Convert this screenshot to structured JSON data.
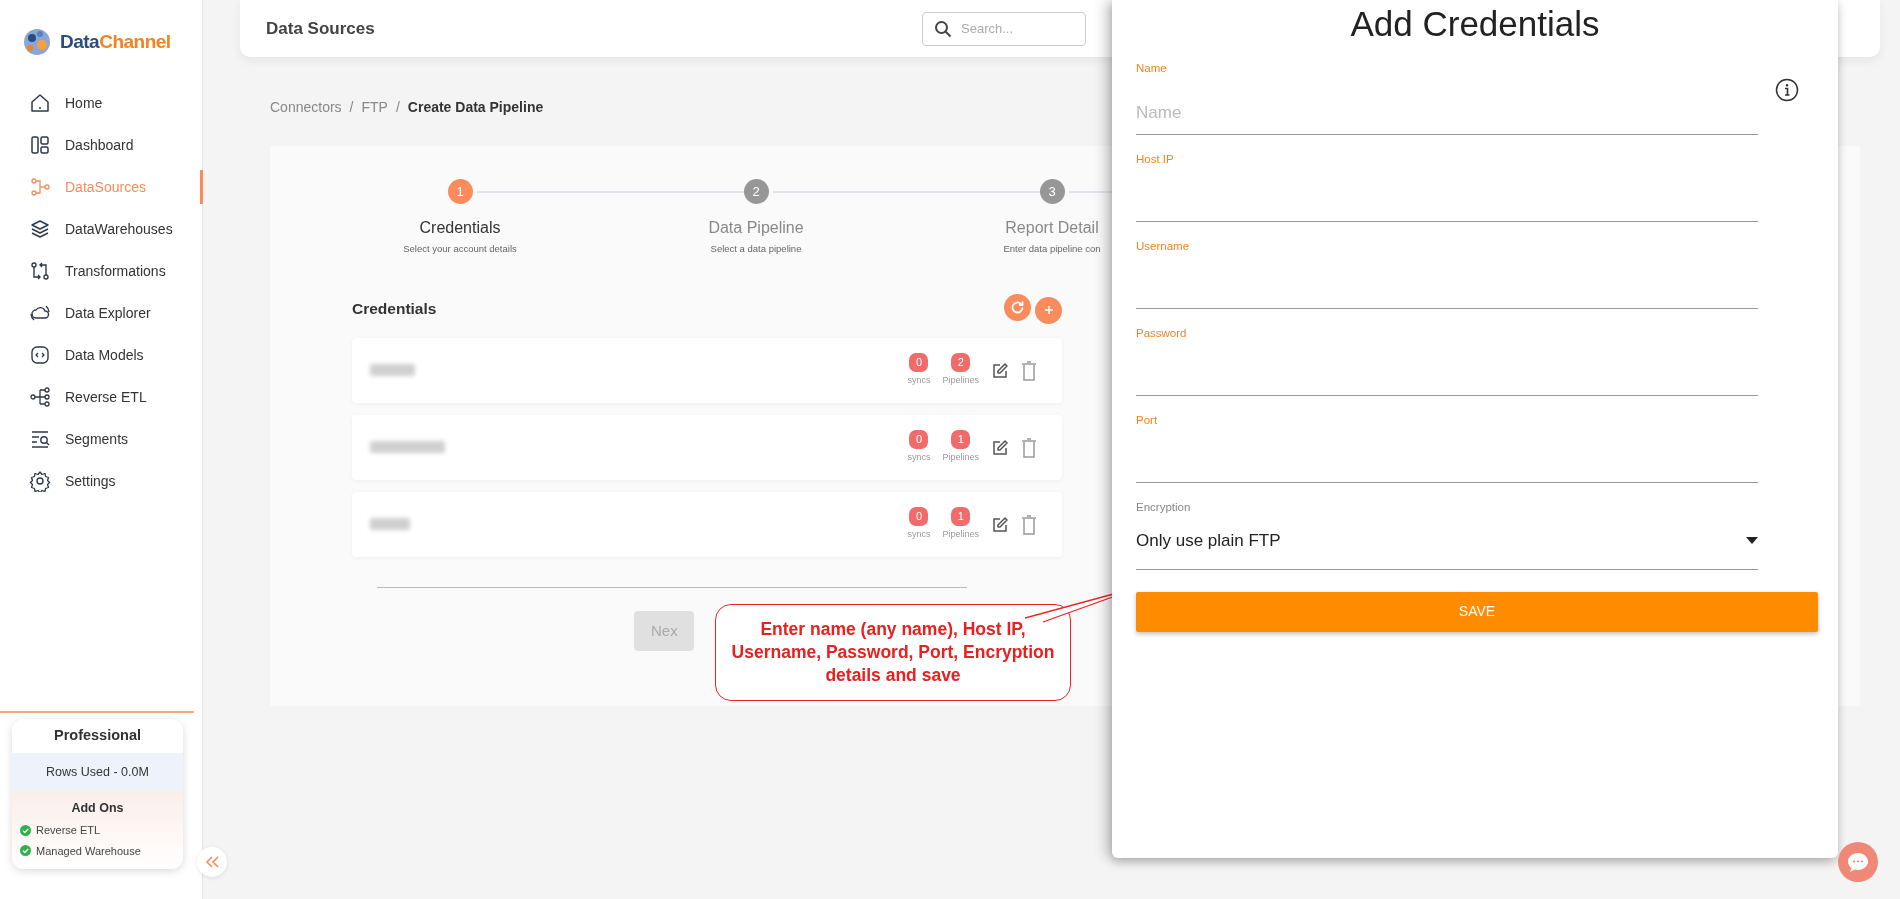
{
  "logo": {
    "first": "Data",
    "second": "Channel"
  },
  "sidebar": {
    "items": [
      {
        "label": "Home",
        "selected": false
      },
      {
        "label": "Dashboard",
        "selected": false
      },
      {
        "label": "DataSources",
        "selected": true
      },
      {
        "label": "DataWarehouses",
        "selected": false
      },
      {
        "label": "Transformations",
        "selected": false
      },
      {
        "label": "Data Explorer",
        "selected": false
      },
      {
        "label": "Data Models",
        "selected": false
      },
      {
        "label": "Reverse ETL",
        "selected": false
      },
      {
        "label": "Segments",
        "selected": false
      },
      {
        "label": "Settings",
        "selected": false
      }
    ]
  },
  "plan": {
    "name": "Professional",
    "usage": "Rows Used - 0.0M",
    "addons_title": "Add Ons",
    "addons": [
      {
        "label": "Reverse ETL",
        "enabled": true
      },
      {
        "label": "Managed Warehouse",
        "enabled": true
      }
    ]
  },
  "header": {
    "title": "Data Sources",
    "search": {
      "placeholder": "Search..."
    }
  },
  "breadcrumbs": [
    {
      "label": "Connectors",
      "current": false
    },
    {
      "label": "FTP",
      "current": false,
      "separator": "/"
    },
    {
      "label": "Create Data Pipeline",
      "current": true,
      "separator": "/"
    }
  ],
  "steps": [
    {
      "number": "1",
      "title": "Credentials",
      "subtitle": "Select your account details",
      "selected": true
    },
    {
      "number": "2",
      "title": "Data Pipeline",
      "subtitle": "Select a data pipeline",
      "selected": false
    },
    {
      "number": "3",
      "title": "Report Detail",
      "subtitle": "Enter data pipeline con",
      "selected": false
    }
  ],
  "credentials": {
    "title": "Credentials",
    "rows": [
      {
        "syncs": "0",
        "syncs_label": "syncs",
        "pipelines": "2",
        "pipelines_label": "Pipelines"
      },
      {
        "syncs": "0",
        "syncs_label": "syncs",
        "pipelines": "1",
        "pipelines_label": "Pipelines"
      },
      {
        "syncs": "0",
        "syncs_label": "syncs",
        "pipelines": "1",
        "pipelines_label": "Pipelines"
      }
    ]
  },
  "next_button": {
    "label": "Nex",
    "disabled": true
  },
  "callout": {
    "text": "Enter name (any name), Host IP, Username, Password, Port, Encryption details and save"
  },
  "drawer": {
    "title": "Add Credentials",
    "fields": [
      {
        "kind": "text",
        "label": "Name",
        "placeholder": "Name"
      },
      {
        "kind": "text",
        "label": "Host IP"
      },
      {
        "kind": "text",
        "label": "Username"
      },
      {
        "kind": "text",
        "label": "Password"
      },
      {
        "kind": "text",
        "label": "Port"
      },
      {
        "kind": "select",
        "label": "Encryption",
        "value": "Only use plain FTP"
      }
    ],
    "save_button": "SAVE"
  }
}
